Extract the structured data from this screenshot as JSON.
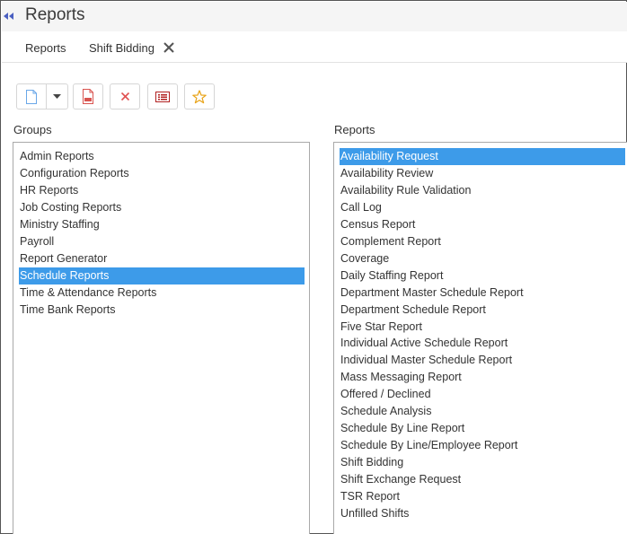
{
  "header": {
    "title": "Reports"
  },
  "tabs": [
    {
      "label": "Reports"
    },
    {
      "label": "Shift Bidding"
    }
  ],
  "toolbar": {
    "buttons": [
      "new-document-icon",
      "dropdown-caret-icon",
      "pdf-icon",
      "delete-icon",
      "list-icon",
      "favorite-star-icon"
    ]
  },
  "groups": {
    "label": "Groups",
    "selected": "Schedule Reports",
    "items": [
      {
        "label": "Admin Reports"
      },
      {
        "label": "Configuration Reports"
      },
      {
        "label": "HR Reports"
      },
      {
        "label": "Job Costing Reports"
      },
      {
        "label": "Ministry Staffing"
      },
      {
        "label": "Payroll"
      },
      {
        "label": "Report Generator"
      },
      {
        "label": "Schedule Reports"
      },
      {
        "label": "Time & Attendance Reports"
      },
      {
        "label": "Time Bank Reports"
      }
    ]
  },
  "reports": {
    "label": "Reports",
    "selected": "Availability Request",
    "items": [
      {
        "label": "Availability Request"
      },
      {
        "label": "Availability Review"
      },
      {
        "label": "Availability Rule Validation"
      },
      {
        "label": "Call Log"
      },
      {
        "label": "Census Report"
      },
      {
        "label": "Complement Report"
      },
      {
        "label": "Coverage"
      },
      {
        "label": "Daily Staffing Report"
      },
      {
        "label": "Department Master Schedule Report"
      },
      {
        "label": "Department Schedule Report"
      },
      {
        "label": "Five Star Report"
      },
      {
        "label": "Individual Active Schedule Report"
      },
      {
        "label": "Individual Master Schedule Report"
      },
      {
        "label": "Mass Messaging Report"
      },
      {
        "label": "Offered / Declined"
      },
      {
        "label": "Schedule Analysis"
      },
      {
        "label": "Schedule By Line Report"
      },
      {
        "label": "Schedule By Line/Employee Report"
      },
      {
        "label": "Shift Bidding"
      },
      {
        "label": "Shift Exchange Request"
      },
      {
        "label": "TSR Report"
      },
      {
        "label": "Unfilled Shifts"
      }
    ]
  },
  "colors": {
    "selection": "#3d9be9",
    "collapse_icon": "#4a5fc1",
    "pdf_red": "#d9534f",
    "delete_red": "#e05252",
    "list_dark_red": "#b22222",
    "star_gold": "#e8a317",
    "doc_blue": "#6aa7e8"
  }
}
